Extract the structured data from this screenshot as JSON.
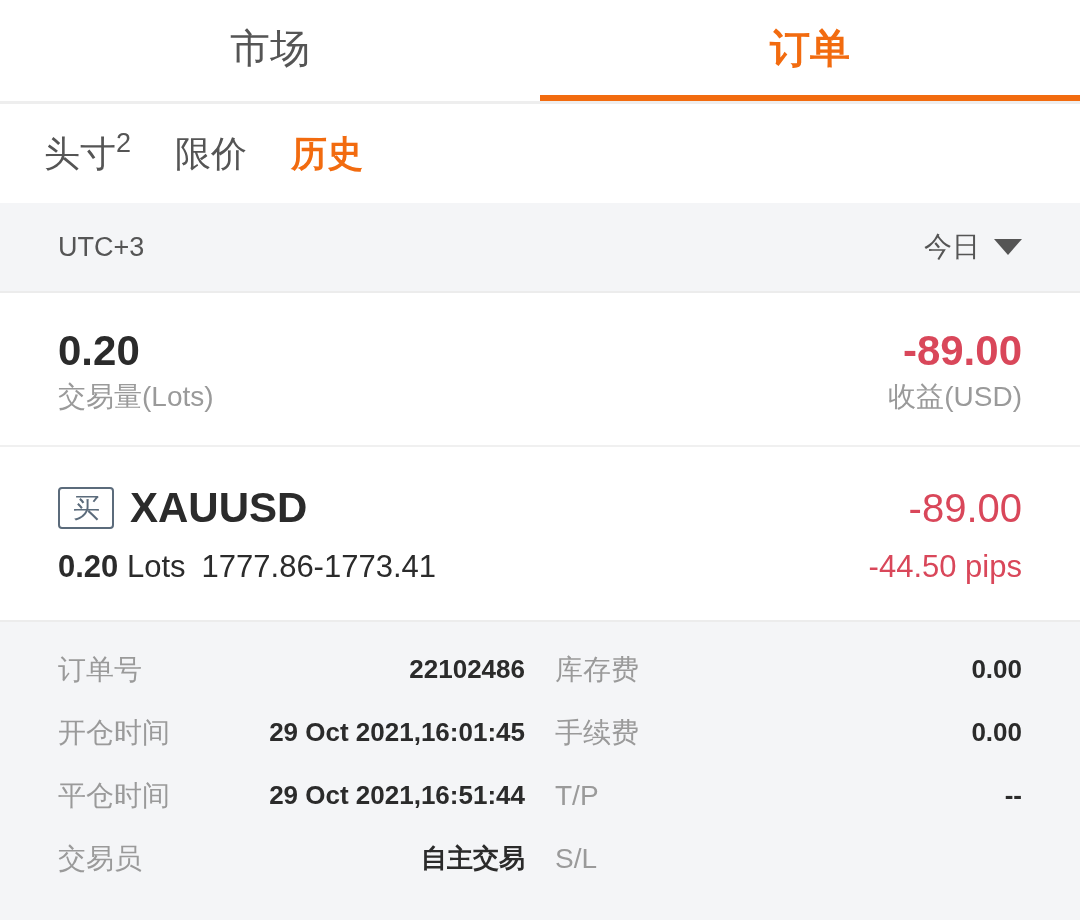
{
  "top_tabs": [
    {
      "label": "市场",
      "selected": false
    },
    {
      "label": "订单",
      "selected": true
    }
  ],
  "sub_tabs": [
    {
      "label": "头寸$^{2}$",
      "selected": false
    },
    {
      "label": "限价",
      "selected": false
    },
    {
      "label": "历史",
      "selected": true
    }
  ],
  "filter_bar": {
    "timezone": "UTC+3",
    "period": "今日"
  },
  "summary": {
    "volume": "0.20",
    "volume_label": "交易量(Lots)",
    "profit": "-89.00",
    "profit_label": "收益(USD)"
  },
  "order": {
    "side": "买",
    "symbol": "XAUUSD",
    "lots": "**0.20** Lots",
    "price_range": "1777.86-1773.41",
    "profit": "-89.00",
    "pips": "-44.50 pips"
  },
  "details": [
    {
      "left": {
        "label": "订单号",
        "value": "22102486"
      },
      "right": {
        "label": "库存费",
        "value": "0.00"
      }
    },
    {
      "left": {
        "label": "开仓时间",
        "value": "29 Oct 2021,16:01:45"
      },
      "right": {
        "label": "手续费",
        "value": "0.00"
      }
    },
    {
      "left": {
        "label": "平仓时间",
        "value": "29 Oct 2021,16:51:44"
      },
      "right": {
        "label": "T/P",
        "value": "--"
      }
    },
    {
      "left": {
        "label": "交易员",
        "value": "自主交易"
      },
      "right": {
        "label": "S/L"
      }
    }
  ]
}
